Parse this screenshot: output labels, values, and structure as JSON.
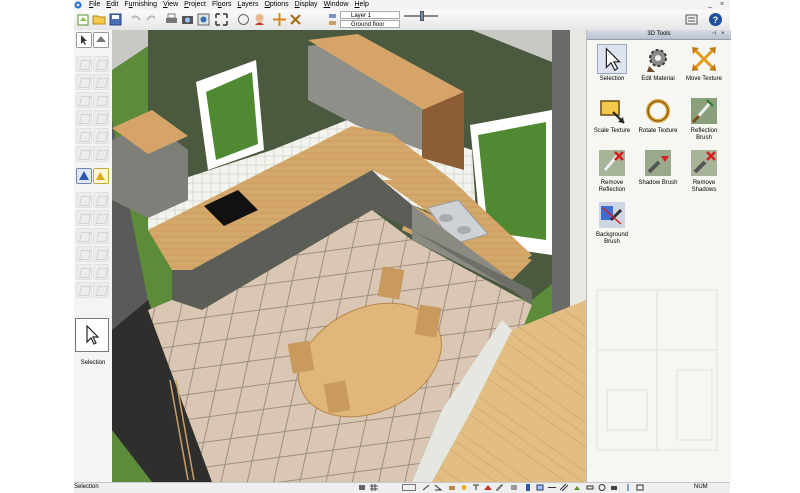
{
  "menu": {
    "items": [
      {
        "pre": "",
        "key": "F",
        "post": "ile"
      },
      {
        "pre": "",
        "key": "E",
        "post": "dit"
      },
      {
        "pre": "F",
        "key": "u",
        "post": "rnishing"
      },
      {
        "pre": "",
        "key": "V",
        "post": "iew"
      },
      {
        "pre": "",
        "key": "P",
        "post": "roject"
      },
      {
        "pre": "Fl",
        "key": "o",
        "post": "ors"
      },
      {
        "pre": "",
        "key": "L",
        "post": "ayers"
      },
      {
        "pre": "",
        "key": "O",
        "post": "ptions"
      },
      {
        "pre": "",
        "key": "D",
        "post": "isplay"
      },
      {
        "pre": "",
        "key": "W",
        "post": "indow"
      },
      {
        "pre": "",
        "key": "H",
        "post": "elp"
      }
    ],
    "minimize": "_",
    "close": "×"
  },
  "toolbar": {
    "layer": "Layer 1",
    "floor": "Ground floor"
  },
  "left_palette": {
    "current_tool": "Selection"
  },
  "tools_panel": {
    "title": "3D Tools",
    "pin": "⊣",
    "close": "×",
    "tools": [
      {
        "label": "Selection"
      },
      {
        "label": "Edit Material"
      },
      {
        "label": "Move Texture"
      },
      {
        "label": "Scale Texture"
      },
      {
        "label": "Rotate Texture"
      },
      {
        "label": "Reflection Brush"
      },
      {
        "label": "Remove Reflection"
      },
      {
        "label": "Shadow Brush"
      },
      {
        "label": "Remove Shadows"
      },
      {
        "label": "Background Brush"
      }
    ]
  },
  "status": {
    "text": "Selection",
    "num": "NUM"
  }
}
